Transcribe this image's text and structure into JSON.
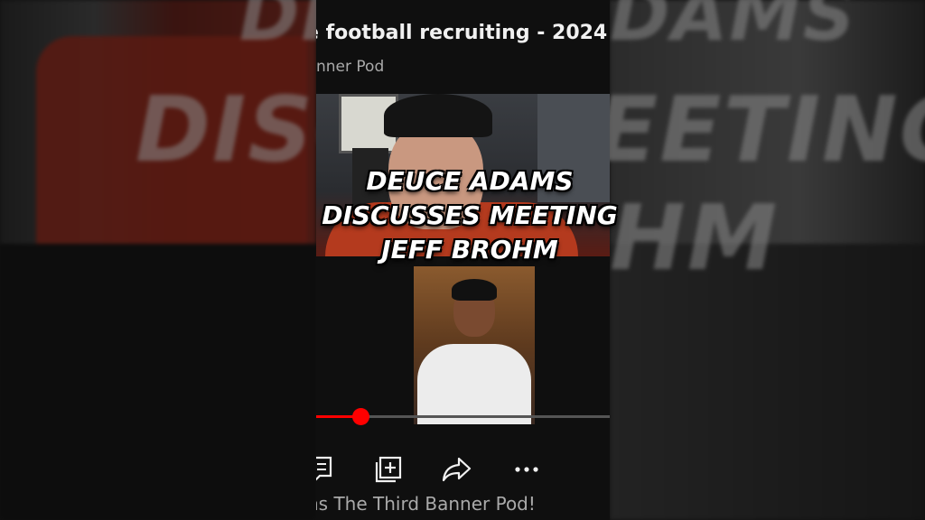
{
  "video": {
    "title": "e football recruiting - 2024",
    "channel": "nner Pod",
    "footer_text": "ns The Third Banner Pod!",
    "progress_fraction": 0.15
  },
  "caption": {
    "lines": [
      "DEUCE ADAMS",
      "DISCUSSES MEETING",
      "JEFF BROHM"
    ]
  },
  "background_text": {
    "left_top": "DIS",
    "left_mid": "DISCU",
    "right_top": "DAMS",
    "right_mid": "EETING",
    "right_bot": "HM"
  },
  "actions": [
    {
      "icon": "comment-icon"
    },
    {
      "icon": "add-to-playlist-icon"
    },
    {
      "icon": "share-icon"
    },
    {
      "icon": "more-icon"
    }
  ],
  "colors": {
    "progress": "#ff0000",
    "caption": "#ffffff"
  }
}
